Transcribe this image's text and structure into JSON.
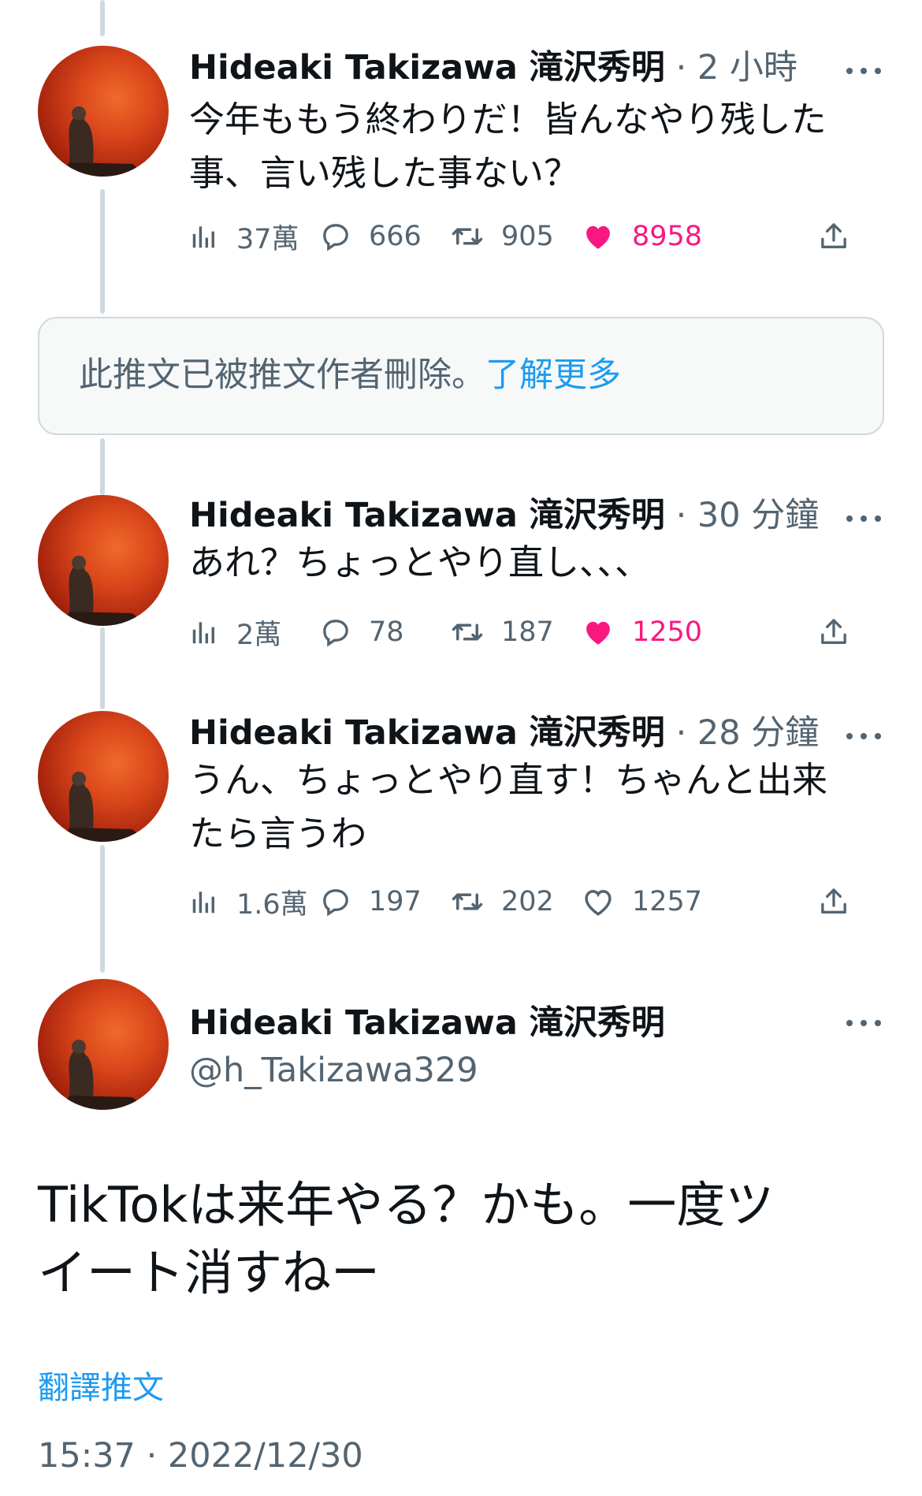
{
  "author": {
    "name": "Hideaki Takizawa 滝沢秀明",
    "handle": "@h_Takizawa329"
  },
  "separator": "·",
  "tweets": [
    {
      "time": "2 小時",
      "text": "今年ももう終わりだ！皆んなやり残した\n事、言い残した事ない？",
      "views": "37萬",
      "replies": "666",
      "retweets": "905",
      "likes": "8958",
      "liked": true
    },
    {
      "time": "30 分鐘",
      "text": "あれ？ちょっとやり直し、、、",
      "views": "2萬",
      "replies": "78",
      "retweets": "187",
      "likes": "1250",
      "liked": true
    },
    {
      "time": "28 分鐘",
      "text": "うん、ちょっとやり直す！ちゃんと出来\nたら言うわ",
      "views": "1.6萬",
      "replies": "197",
      "retweets": "202",
      "likes": "1257",
      "liked": false
    }
  ],
  "deleted_notice": {
    "text": "此推文已被推文作者刪除。",
    "link": "了解更多"
  },
  "main_tweet": {
    "text": "TikTokは来年やる？かも。一度ツ\nイート消すねー",
    "translate_label": "翻譯推文",
    "timestamp": "15:37 · 2022/12/30"
  },
  "colors": {
    "like_active": "#f91880",
    "link": "#1d9bf0",
    "secondary": "#536471",
    "thread_line": "#cfd9de"
  },
  "icons": [
    "views-icon",
    "reply-icon",
    "retweet-icon",
    "heart-icon",
    "share-icon",
    "more-icon"
  ]
}
